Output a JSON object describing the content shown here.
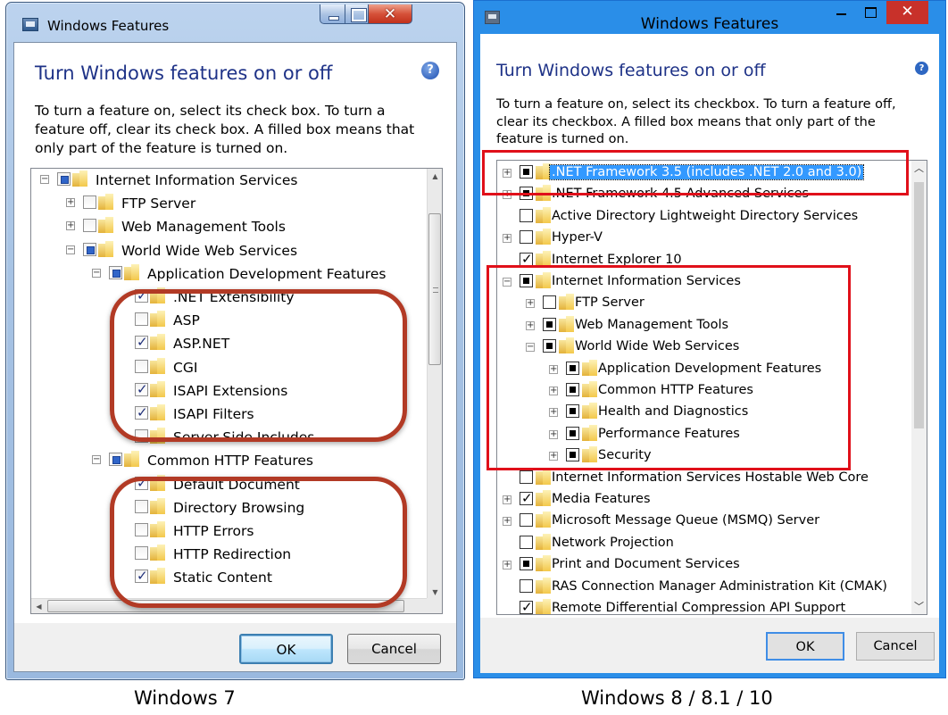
{
  "win7": {
    "window_title": "Windows Features",
    "heading": "Turn Windows features on or off",
    "help": "?",
    "description": "To turn a feature on, select its check box. To turn a feature off, clear its check box. A filled box means that only part of the feature is turned on.",
    "tree": [
      {
        "label": "Internet Information Services",
        "level": 0,
        "expander": "minus",
        "state": "partial"
      },
      {
        "label": "FTP Server",
        "level": 1,
        "expander": "plus",
        "state": "unchecked"
      },
      {
        "label": "Web Management Tools",
        "level": 1,
        "expander": "plus",
        "state": "unchecked"
      },
      {
        "label": "World Wide Web Services",
        "level": 1,
        "expander": "minus",
        "state": "partial"
      },
      {
        "label": "Application Development Features",
        "level": 2,
        "expander": "minus",
        "state": "partial"
      },
      {
        "label": ".NET Extensibility",
        "level": 3,
        "expander": "none",
        "state": "checked"
      },
      {
        "label": "ASP",
        "level": 3,
        "expander": "none",
        "state": "unchecked"
      },
      {
        "label": "ASP.NET",
        "level": 3,
        "expander": "none",
        "state": "checked"
      },
      {
        "label": "CGI",
        "level": 3,
        "expander": "none",
        "state": "unchecked"
      },
      {
        "label": "ISAPI Extensions",
        "level": 3,
        "expander": "none",
        "state": "checked"
      },
      {
        "label": "ISAPI Filters",
        "level": 3,
        "expander": "none",
        "state": "checked"
      },
      {
        "label": "Server-Side Includes",
        "level": 3,
        "expander": "none",
        "state": "unchecked"
      },
      {
        "label": "Common HTTP Features",
        "level": 2,
        "expander": "minus",
        "state": "partial"
      },
      {
        "label": "Default Document",
        "level": 3,
        "expander": "none",
        "state": "checked"
      },
      {
        "label": "Directory Browsing",
        "level": 3,
        "expander": "none",
        "state": "unchecked"
      },
      {
        "label": "HTTP Errors",
        "level": 3,
        "expander": "none",
        "state": "unchecked"
      },
      {
        "label": "HTTP Redirection",
        "level": 3,
        "expander": "none",
        "state": "unchecked"
      },
      {
        "label": "Static Content",
        "level": 3,
        "expander": "none",
        "state": "checked"
      }
    ],
    "ok_label": "OK",
    "cancel_label": "Cancel",
    "caption": "Windows 7",
    "highlight_color": "#b23a25"
  },
  "win8": {
    "window_title": "Windows Features",
    "heading": "Turn Windows features on or off",
    "help": "?",
    "description": "To turn a feature on, select its checkbox. To turn a feature off, clear its checkbox. A filled box means that only part of the feature is turned on.",
    "tree": [
      {
        "label": ".NET Framework 3.5 (includes .NET 2.0 and 3.0)",
        "level": 0,
        "expander": "plus",
        "state": "partial",
        "selected": true
      },
      {
        "label": ".NET Framework 4.5 Advanced Services",
        "level": 0,
        "expander": "plus",
        "state": "partial"
      },
      {
        "label": "Active Directory Lightweight Directory Services",
        "level": 0,
        "expander": "none",
        "state": "unchecked"
      },
      {
        "label": "Hyper-V",
        "level": 0,
        "expander": "plus",
        "state": "unchecked"
      },
      {
        "label": "Internet Explorer 10",
        "level": 0,
        "expander": "none",
        "state": "checked"
      },
      {
        "label": "Internet Information Services",
        "level": 0,
        "expander": "minus",
        "state": "partial"
      },
      {
        "label": "FTP Server",
        "level": 1,
        "expander": "plus",
        "state": "unchecked"
      },
      {
        "label": "Web Management Tools",
        "level": 1,
        "expander": "plus",
        "state": "partial"
      },
      {
        "label": "World Wide Web Services",
        "level": 1,
        "expander": "minus",
        "state": "partial"
      },
      {
        "label": "Application Development Features",
        "level": 2,
        "expander": "plus",
        "state": "partial"
      },
      {
        "label": "Common HTTP Features",
        "level": 2,
        "expander": "plus",
        "state": "partial"
      },
      {
        "label": "Health and Diagnostics",
        "level": 2,
        "expander": "plus",
        "state": "partial"
      },
      {
        "label": "Performance Features",
        "level": 2,
        "expander": "plus",
        "state": "partial"
      },
      {
        "label": "Security",
        "level": 2,
        "expander": "plus",
        "state": "partial"
      },
      {
        "label": "Internet Information Services Hostable Web Core",
        "level": 0,
        "expander": "none",
        "state": "unchecked"
      },
      {
        "label": "Media Features",
        "level": 0,
        "expander": "plus",
        "state": "checked"
      },
      {
        "label": "Microsoft Message Queue (MSMQ) Server",
        "level": 0,
        "expander": "plus",
        "state": "unchecked"
      },
      {
        "label": "Network Projection",
        "level": 0,
        "expander": "none",
        "state": "unchecked"
      },
      {
        "label": "Print and Document Services",
        "level": 0,
        "expander": "plus",
        "state": "partial"
      },
      {
        "label": "RAS Connection Manager Administration Kit (CMAK)",
        "level": 0,
        "expander": "none",
        "state": "unchecked"
      },
      {
        "label": "Remote Differential Compression API Support",
        "level": 0,
        "expander": "none",
        "state": "checked"
      }
    ],
    "ok_label": "OK",
    "cancel_label": "Cancel",
    "caption": "Windows 8 / 8.1 / 10",
    "highlight_color": "#e0101a",
    "title_bar_color": "#2a8ee8"
  }
}
